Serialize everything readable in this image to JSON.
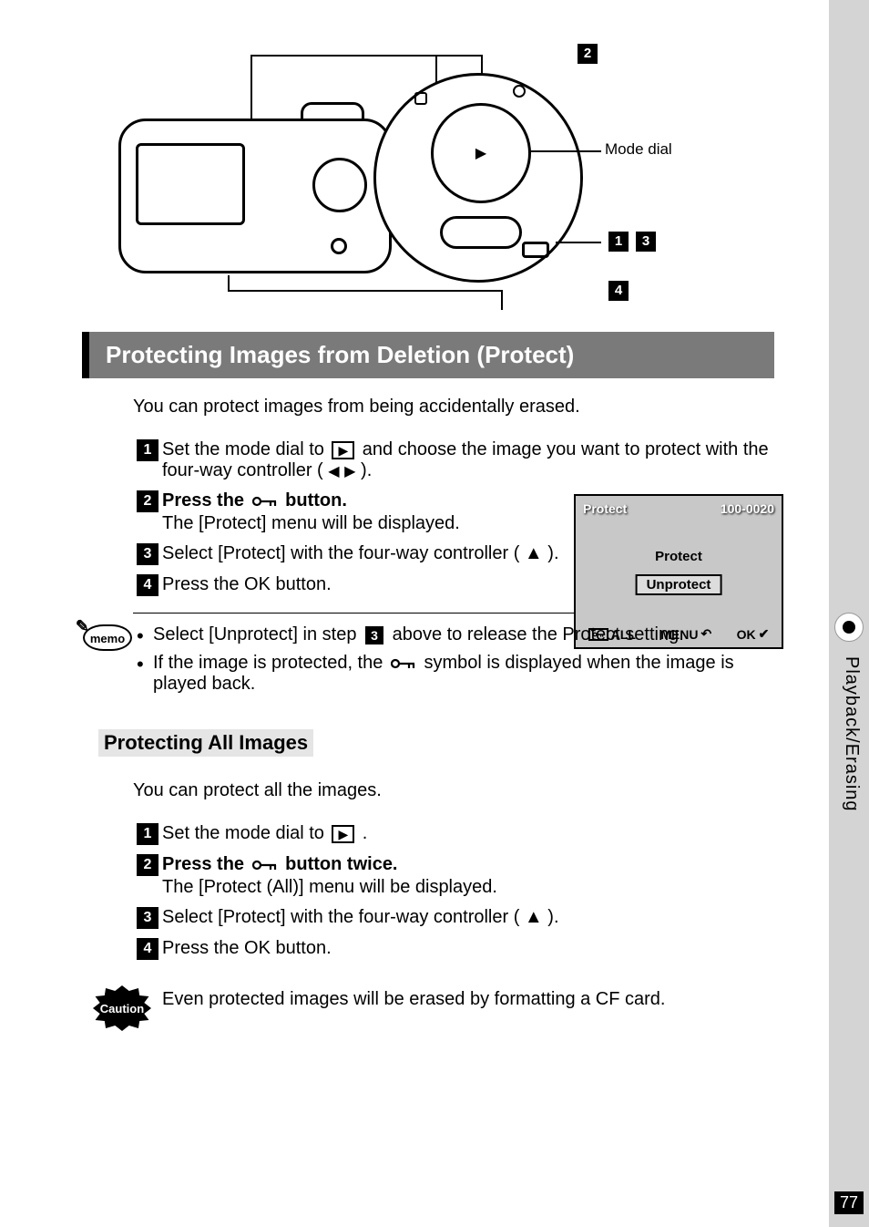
{
  "diagram": {
    "callout_2": "2",
    "callout_1": "1",
    "callout_3": "3",
    "callout_4": "4",
    "mode_dial_label": "Mode dial"
  },
  "heading": "Protecting Images from Deletion (Protect)",
  "intro": "You can protect images from being accidentally erased.",
  "steps_a": {
    "s1_num": "1",
    "s1_a": "Set the mode dial to ",
    "s1_b": " and choose the image you want to protect with the four-way controller ( ",
    "s1_c": " ).",
    "s2_num": "2",
    "s2_a": "Press the ",
    "s2_b": " button.",
    "s2_sub": "The [Protect] menu will be displayed.",
    "s3_num": "3",
    "s3_text": "Select [Protect] with the four-way controller ( ▲ ).",
    "s4_num": "4",
    "s4_text": "Press the OK button."
  },
  "screen": {
    "title": "Protect",
    "image_id": "100-0020",
    "opt_protect": "Protect",
    "opt_unprotect": "Unprotect",
    "bar_all": "ALL",
    "bar_menu": "MENU",
    "bar_ok": "OK"
  },
  "memo": {
    "label": "memo",
    "item1_a": "Select [Unprotect] in step ",
    "item1_num": "3",
    "item1_b": " above to release the Protect setting.",
    "item2_a": "If the image is protected, the ",
    "item2_b": " symbol is displayed when the image is played back."
  },
  "sub_heading": "Protecting All Images",
  "intro2": "You can protect all the images.",
  "steps_b": {
    "s1_num": "1",
    "s1_a": "Set the mode dial to ",
    "s1_b": " .",
    "s2_num": "2",
    "s2_a": "Press the ",
    "s2_b": " button twice.",
    "s2_sub": "The [Protect (All)] menu will be displayed.",
    "s3_num": "3",
    "s3_text": "Select [Protect] with the four-way controller ( ▲ ).",
    "s4_num": "4",
    "s4_text": "Press the OK button."
  },
  "caution": {
    "label": "Caution",
    "text": "Even protected images will be erased by formatting a CF card."
  },
  "side_tab": "Playback/Erasing",
  "page_number": "77"
}
